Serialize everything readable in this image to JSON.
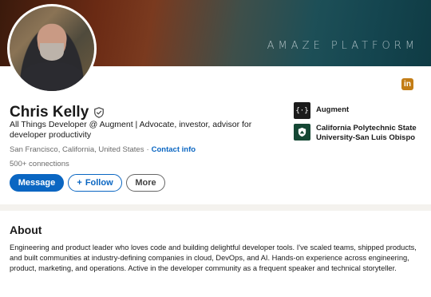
{
  "banner": {
    "text": "AMAZE PLATFORM"
  },
  "profile": {
    "name": "Chris Kelly",
    "headline": "All Things Developer @ Augment | Advocate, investor, advisor for developer productivity",
    "location": "San Francisco, California, United States",
    "contact_label": "Contact info",
    "connections": "500+ connections"
  },
  "badge": {
    "label": "in"
  },
  "actions": {
    "message_label": "Message",
    "follow_label": "Follow",
    "more_label": "More"
  },
  "orgs": [
    {
      "name": "Augment",
      "logo_icon": "augment-logo-icon"
    },
    {
      "name": "California Polytechnic State University-San Luis Obispo",
      "logo_icon": "cal-poly-logo-icon"
    }
  ],
  "about": {
    "title": "About",
    "text": "Engineering and product leader who loves code and building delightful developer tools. I've scaled teams, shipped products, and built communities at industry-defining companies in cloud, DevOps, and AI. Hands-on experience across engineering, product, marketing, and operations. Active in the developer community as a frequent speaker and technical storyteller."
  },
  "colors": {
    "accent": "#0a66c2",
    "premium_badge": "#c37d16",
    "cal_poly_green": "#154734"
  }
}
